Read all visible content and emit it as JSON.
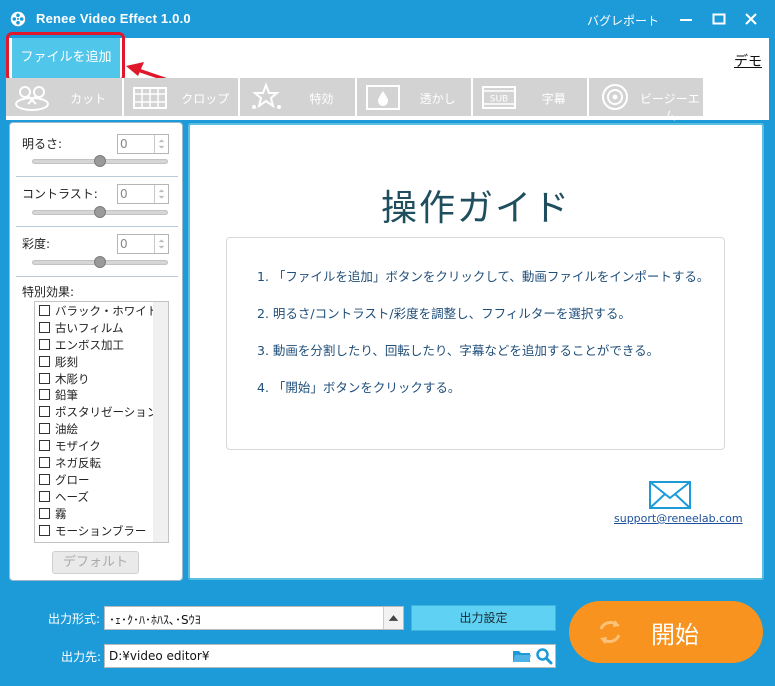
{
  "window": {
    "title": "Renee Video Effect 1.0.0",
    "bug_report": "バグレポート"
  },
  "toolbar": {
    "add_file": "ファイルを追加",
    "demo": "デモ",
    "tabs": [
      {
        "label": "カット",
        "icon": "cut-icon"
      },
      {
        "label": "クロップ",
        "icon": "crop-icon"
      },
      {
        "label": "特効",
        "icon": "effects-icon"
      },
      {
        "label": "透かし",
        "icon": "watermark-icon"
      },
      {
        "label": "字幕",
        "icon": "subtitle-icon"
      },
      {
        "label": "ビージーエム",
        "icon": "bgm-icon"
      }
    ]
  },
  "adjust": {
    "brightness_label": "明るさ:",
    "brightness_value": "0",
    "brightness_level": 0.5,
    "contrast_label": "コントラスト:",
    "contrast_value": "0",
    "contrast_level": 0.5,
    "saturation_label": "彩度:",
    "saturation_value": "0",
    "saturation_level": 0.5
  },
  "effects": {
    "title": "特別効果:",
    "items": [
      "バラック・ホワイト",
      "古いフィルム",
      "エンボス加工",
      "彫刻",
      "木彫り",
      "鉛筆",
      "ポスタリゼーション",
      "油絵",
      "モザイク",
      "ネガ反転",
      "グロー",
      "ヘーズ",
      "霧",
      "モーションブラー"
    ],
    "default_button": "デフォルト"
  },
  "guide": {
    "title": "操作ガイド",
    "steps": [
      "1. 「ファイルを追加」ボタンをクリックして、動画ファイルをインポートする。",
      "2. 明るさ/コントラスト/彩度を調整し、フフィルターを選択する。",
      "3. 動画を分割したり、回転したり、字幕などを追加することができる。",
      "4. 「開始」ボタンをクリックする。"
    ],
    "support_email": "support@reneelab.com"
  },
  "output": {
    "format_label": "出力形式:",
    "format_value": "･ｪ･ｸ･ﾊ･ﾎﾊｽ､･Sｳﾖ",
    "settings_button": "出力設定",
    "dest_label": "出力先:",
    "dest_value": "D:¥video editor¥",
    "start_button": "開始"
  },
  "colors": {
    "brand_blue": "#1d9bd9",
    "accent_cyan": "#4fc6ea",
    "start_orange": "#f7931e",
    "highlight_red": "#e0182b"
  }
}
